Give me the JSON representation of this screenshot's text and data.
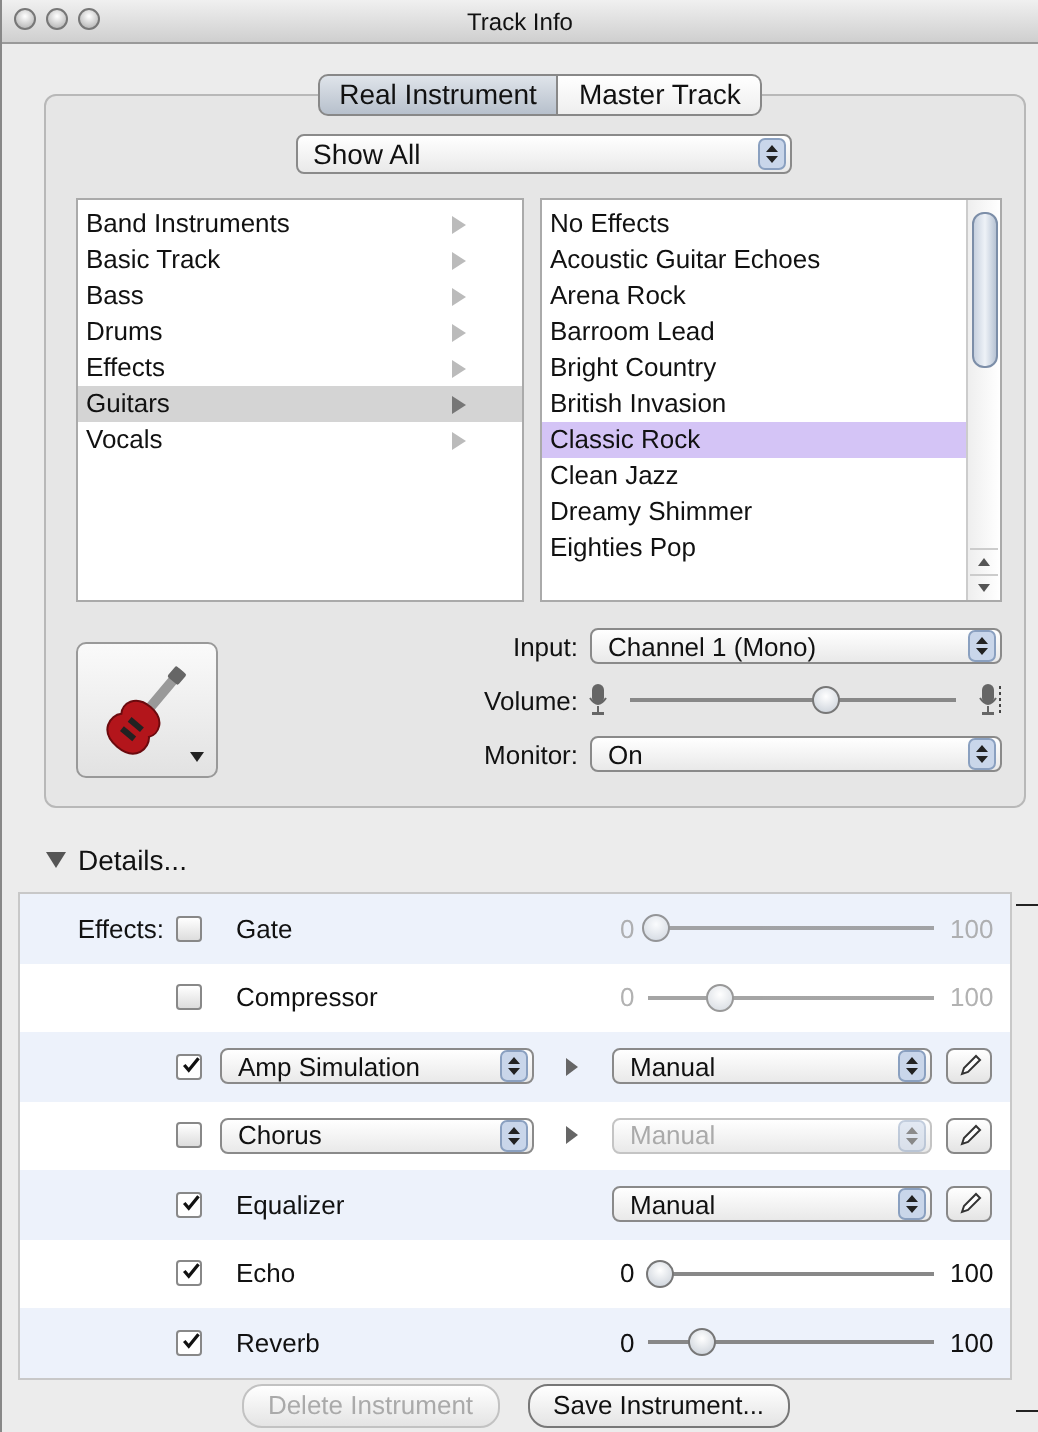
{
  "window": {
    "title": "Track Info"
  },
  "tabs": [
    {
      "label": "Real Instrument",
      "selected": true
    },
    {
      "label": "Master Track",
      "selected": false
    }
  ],
  "filter": {
    "value": "Show All"
  },
  "categories": [
    {
      "label": "Band Instruments",
      "selected": false
    },
    {
      "label": "Basic Track",
      "selected": false
    },
    {
      "label": "Bass",
      "selected": false
    },
    {
      "label": "Drums",
      "selected": false
    },
    {
      "label": "Effects",
      "selected": false
    },
    {
      "label": "Guitars",
      "selected": true
    },
    {
      "label": "Vocals",
      "selected": false
    }
  ],
  "presets": [
    {
      "label": "No Effects",
      "selected": false
    },
    {
      "label": "Acoustic Guitar Echoes",
      "selected": false
    },
    {
      "label": "Arena Rock",
      "selected": false
    },
    {
      "label": "Barroom Lead",
      "selected": false
    },
    {
      "label": "Bright Country",
      "selected": false
    },
    {
      "label": "British Invasion",
      "selected": false
    },
    {
      "label": "Classic Rock",
      "selected": true
    },
    {
      "label": "Clean Jazz",
      "selected": false
    },
    {
      "label": "Dreamy Shimmer",
      "selected": false
    },
    {
      "label": "Eighties Pop",
      "selected": false
    }
  ],
  "input": {
    "label": "Input:",
    "value": "Channel 1 (Mono)"
  },
  "volume": {
    "label": "Volume:",
    "level": 0.6
  },
  "monitor": {
    "label": "Monitor:",
    "value": "On"
  },
  "details": {
    "label": "Details...",
    "expanded": true
  },
  "effects": {
    "label": "Effects:",
    "items": [
      {
        "kind": "slider",
        "name": "Gate",
        "checked": false,
        "min": "0",
        "max": "100",
        "level": 0.03
      },
      {
        "kind": "slider",
        "name": "Compressor",
        "checked": false,
        "min": "0",
        "max": "100",
        "level": 0.25
      },
      {
        "kind": "popup",
        "name": "Amp Simulation",
        "checked": true,
        "preset": "Manual",
        "preset_disabled": false
      },
      {
        "kind": "popup",
        "name": "Chorus",
        "checked": false,
        "preset": "Manual",
        "preset_disabled": true
      },
      {
        "kind": "preset",
        "name": "Equalizer",
        "checked": true,
        "preset": "Manual",
        "preset_disabled": false
      },
      {
        "kind": "slider",
        "name": "Echo",
        "checked": true,
        "min": "0",
        "max": "100",
        "level": 0.04
      },
      {
        "kind": "slider",
        "name": "Reverb",
        "checked": true,
        "min": "0",
        "max": "100",
        "level": 0.19
      }
    ]
  },
  "buttons": [
    {
      "label": "Delete Instrument",
      "disabled": true
    },
    {
      "label": "Save Instrument...",
      "disabled": false
    }
  ]
}
